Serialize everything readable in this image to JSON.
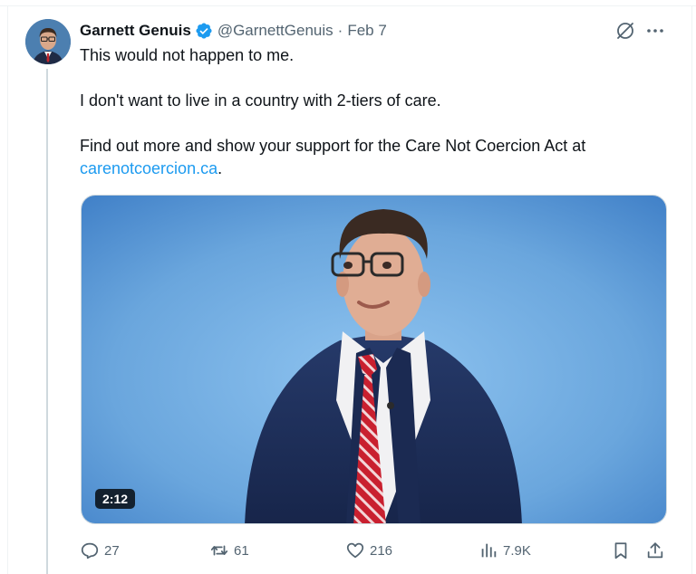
{
  "tweet": {
    "author": {
      "display_name": "Garnett Genuis",
      "handle": "@GarnettGenuis",
      "verified": true
    },
    "separator": "·",
    "date": "Feb 7",
    "lines": [
      "This would not happen to me.",
      "I don't want to live in a country with 2-tiers of care.",
      "Find out more and show your support for the Care Not Coercion Act at"
    ],
    "link_text": "carenotcoercion.ca",
    "link_suffix": ".",
    "media": {
      "type": "video",
      "duration": "2:12"
    },
    "actions": {
      "replies": "27",
      "reposts": "61",
      "likes": "216",
      "views": "7.9K"
    }
  },
  "colors": {
    "accent": "#1d9bf0",
    "text": "#0f1419",
    "muted": "#536471",
    "thread_line": "#cfd9de"
  }
}
